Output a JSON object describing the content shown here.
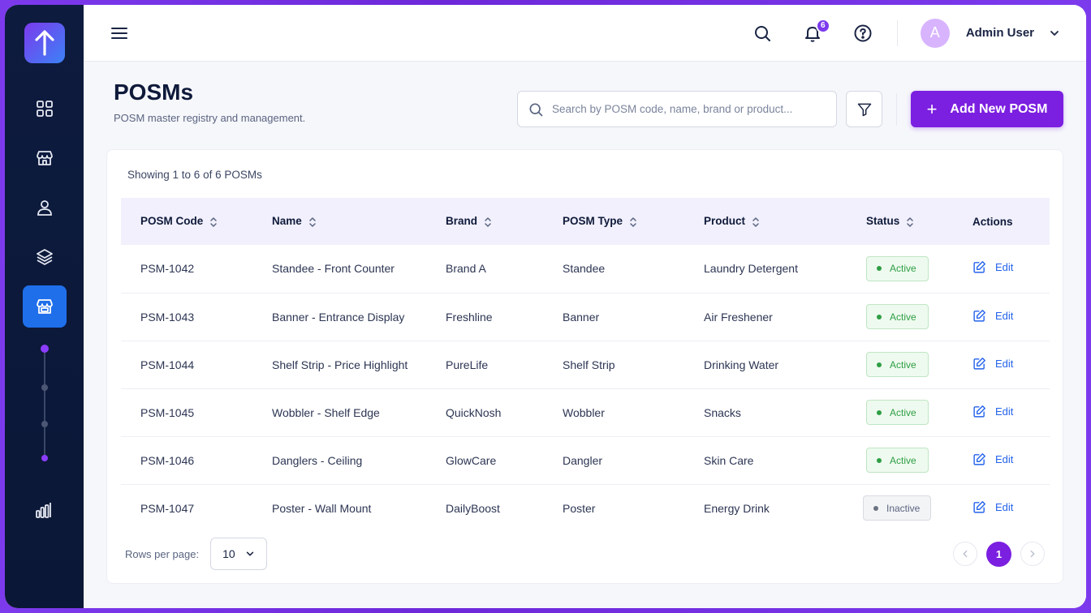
{
  "sidebar": {
    "logo_icon": "arrow-up-logo-icon",
    "items": [
      {
        "icon": "dashboard-grid-icon"
      },
      {
        "icon": "store-icon"
      },
      {
        "icon": "user-icon"
      },
      {
        "icon": "layers-icon"
      },
      {
        "icon": "storefront-icon",
        "active": true
      },
      {
        "icon": "bar-chart-icon"
      }
    ],
    "accent": "#8b3dff",
    "active_bg": "#1f6feb"
  },
  "topbar": {
    "notification_count": "6",
    "avatar_initial": "A",
    "user_name": "Admin User"
  },
  "page": {
    "title": "POSMs",
    "subtitle": "POSM master registry and management.",
    "search_placeholder": "Search by POSM code, name, brand or product...",
    "add_button_label": "Add New POSM",
    "add_button_icon": "+"
  },
  "table": {
    "showing_text": "Showing 1 to 6 of 6 POSMs",
    "columns": [
      "POSM Code",
      "Name",
      "Brand",
      "POSM Type",
      "Product",
      "Status",
      "Actions"
    ],
    "rows": [
      {
        "code": "PSM-1042",
        "name": "Standee - Front Counter",
        "brand": "Brand A",
        "type": "Standee",
        "product": "Laundry Detergent",
        "status": "Active",
        "action": "Edit"
      },
      {
        "code": "PSM-1043",
        "name": "Banner - Entrance Display",
        "brand": "Freshline",
        "type": "Banner",
        "product": "Air Freshener",
        "status": "Active",
        "action": "Edit"
      },
      {
        "code": "PSM-1044",
        "name": "Shelf Strip - Price Highlight",
        "brand": "PureLife",
        "type": "Shelf Strip",
        "product": "Drinking Water",
        "status": "Active",
        "action": "Edit"
      },
      {
        "code": "PSM-1045",
        "name": "Wobbler - Shelf Edge",
        "brand": "QuickNosh",
        "type": "Wobbler",
        "product": "Snacks",
        "status": "Active",
        "action": "Edit"
      },
      {
        "code": "PSM-1046",
        "name": "Danglers - Ceiling",
        "brand": "GlowCare",
        "type": "Dangler",
        "product": "Skin Care",
        "status": "Active",
        "action": "Edit"
      },
      {
        "code": "PSM-1047",
        "name": "Poster - Wall Mount",
        "brand": "DailyBoost",
        "type": "Poster",
        "product": "Energy Drink",
        "status": "Inactive",
        "action": "Edit"
      }
    ]
  },
  "footer": {
    "rows_per_page_label": "Rows per page:",
    "rows_per_page_value": "10",
    "current_page": "1"
  },
  "colors": {
    "primary": "#7b1fe0",
    "active_status": "#2f9e44",
    "link": "#2563eb"
  }
}
